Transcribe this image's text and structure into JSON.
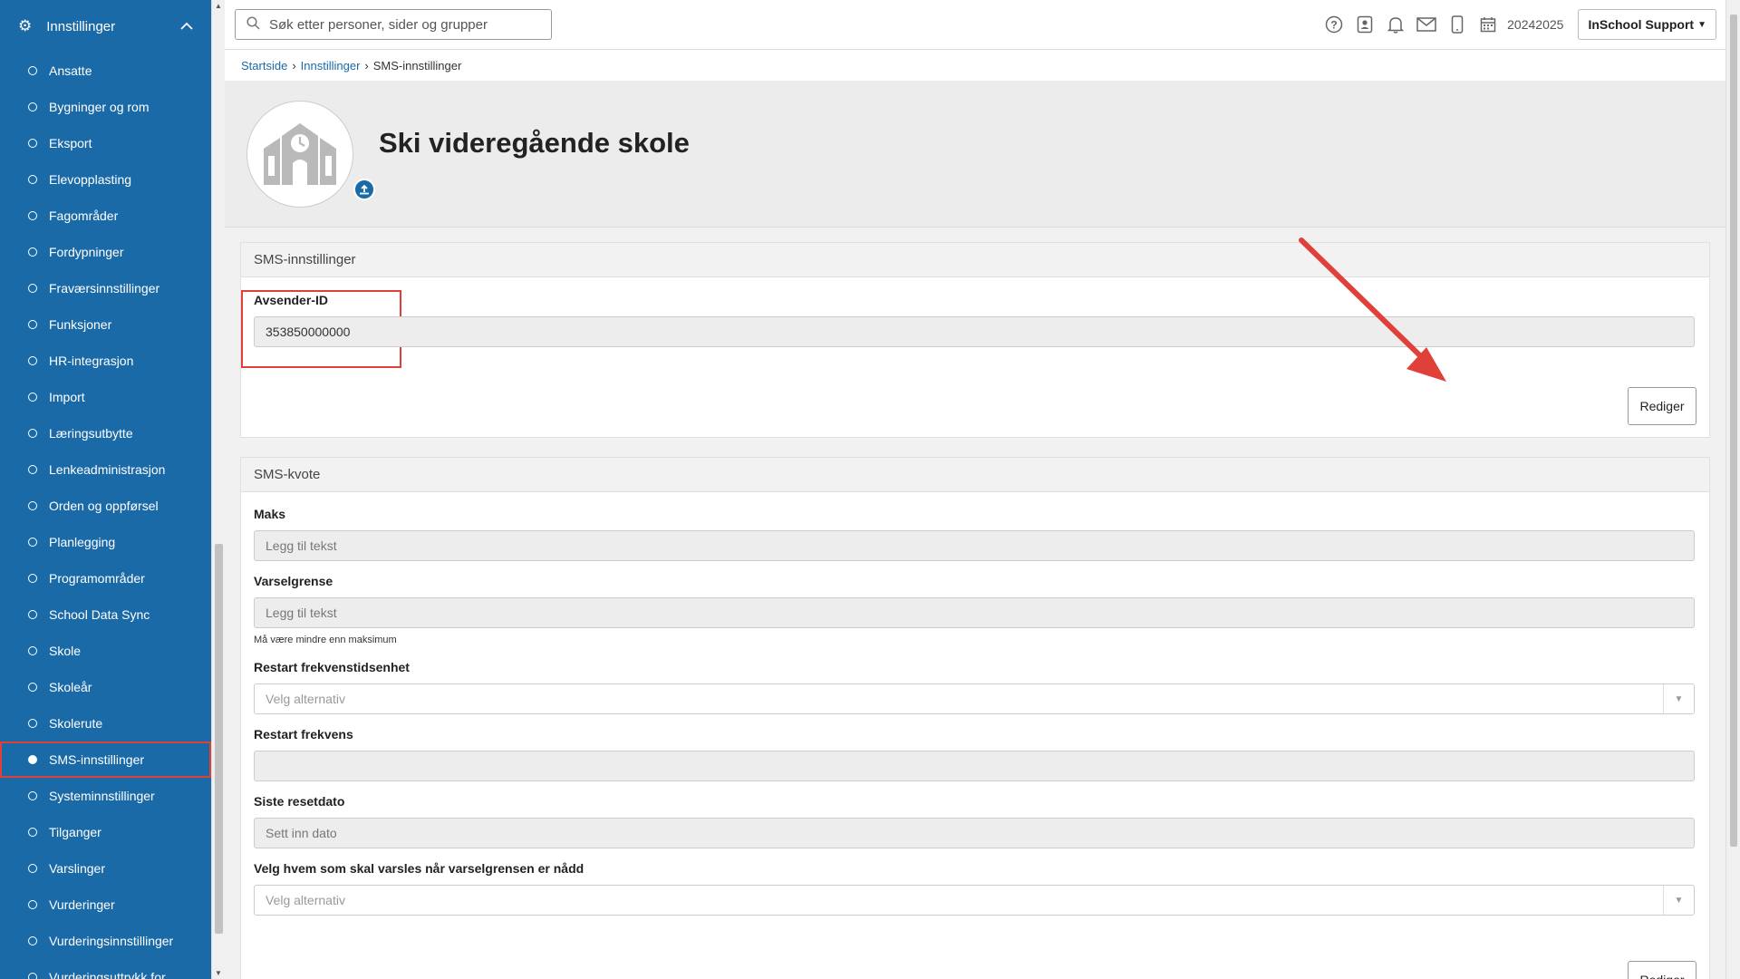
{
  "sidebar": {
    "header_label": "Innstillinger",
    "items": [
      {
        "label": "Ansatte"
      },
      {
        "label": "Bygninger og rom"
      },
      {
        "label": "Eksport"
      },
      {
        "label": "Elevopplasting"
      },
      {
        "label": "Fagområder"
      },
      {
        "label": "Fordypninger"
      },
      {
        "label": "Fraværsinnstillinger"
      },
      {
        "label": "Funksjoner"
      },
      {
        "label": "HR-integrasjon"
      },
      {
        "label": "Import"
      },
      {
        "label": "Læringsutbytte"
      },
      {
        "label": "Lenkeadministrasjon"
      },
      {
        "label": "Orden og oppførsel"
      },
      {
        "label": "Planlegging"
      },
      {
        "label": "Programområder"
      },
      {
        "label": "School Data Sync"
      },
      {
        "label": "Skole"
      },
      {
        "label": "Skoleår"
      },
      {
        "label": "Skolerute"
      },
      {
        "label": "SMS-innstillinger",
        "active": true
      },
      {
        "label": "Systeminnstillinger"
      },
      {
        "label": "Tilganger"
      },
      {
        "label": "Varslinger"
      },
      {
        "label": "Vurderinger"
      },
      {
        "label": "Vurderingsinnstillinger"
      },
      {
        "label": "Vurderingsuttrykk for"
      }
    ]
  },
  "topbar": {
    "search_placeholder": "Søk etter personer, sider og grupper",
    "year": "20242025",
    "user_menu": "InSchool Support",
    "icons": [
      "help-icon",
      "contact-card-icon",
      "bell-icon",
      "mail-icon",
      "mobile-icon",
      "calendar-icon"
    ]
  },
  "breadcrumb": {
    "home": "Startside",
    "parent": "Innstillinger",
    "current": "SMS-innstillinger"
  },
  "school": {
    "name": "Ski videregående skole"
  },
  "sms_settings": {
    "title": "SMS-innstillinger",
    "sender_label": "Avsender-ID",
    "sender_value": "353850000000",
    "edit_button": "Rediger"
  },
  "sms_quota": {
    "title": "SMS-kvote",
    "max_label": "Maks",
    "max_placeholder": "Legg til tekst",
    "threshold_label": "Varselgrense",
    "threshold_placeholder": "Legg til tekst",
    "threshold_hint": "Må være mindre enn maksimum",
    "restart_unit_label": "Restart frekvenstidsenhet",
    "restart_unit_placeholder": "Velg alternativ",
    "restart_freq_label": "Restart frekvens",
    "restart_freq_value": "",
    "last_reset_label": "Siste resetdato",
    "last_reset_placeholder": "Sett inn dato",
    "notify_label": "Velg hvem som skal varsles når varselgrensen er nådd",
    "notify_placeholder": "Velg alternativ",
    "edit_button": "Rediger"
  },
  "colors": {
    "sidebar": "#1a6aa8",
    "highlight": "#e0403a",
    "link": "#1a6aa8"
  }
}
